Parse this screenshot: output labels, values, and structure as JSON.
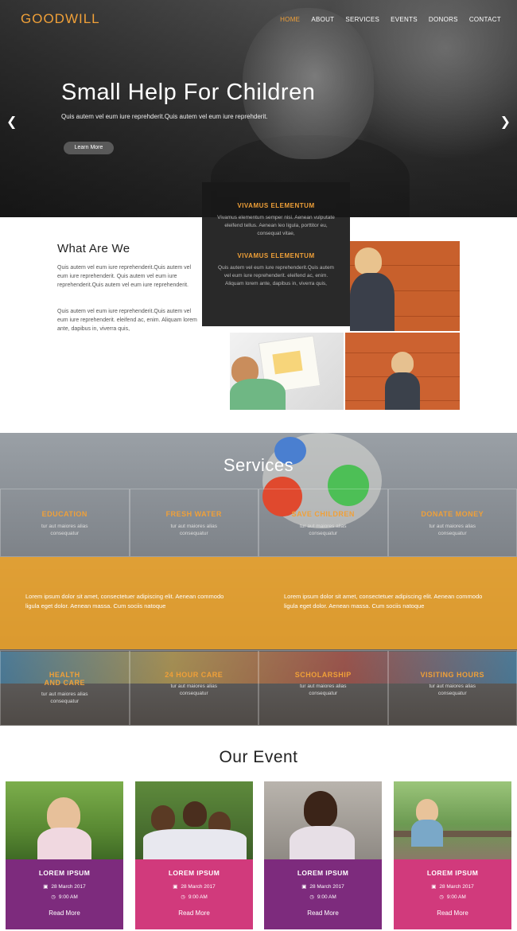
{
  "brand": {
    "logo": "GOODWILL"
  },
  "nav": [
    "HOME",
    "ABOUT",
    "SERVICES",
    "EVENTS",
    "DONORS",
    "CONTACT"
  ],
  "hero": {
    "title": "Small Help For Children",
    "subtitle": "Quis autem vel eum iure reprehderit.Quis autem vel eum iure reprehderit.",
    "button": "Learn More",
    "prev_icon": "chevron-left-icon",
    "next_icon": "chevron-right-icon"
  },
  "about": {
    "title": "What Are We",
    "p1": "Quis autem vel eum iure reprehenderit.Quis autem vel eum iure reprehenderit. Quis autem vel eum iure reprehenderit.Quis autem vel eum iure reprehenderit.",
    "p2": "Quis autem vel eum iure reprehenderit.Quis autem vel eum iure reprehenderit. eleifend ac, enim. Aliquam lorem ante, dapibus in, viverra quis,",
    "box": [
      {
        "heading": "VIVAMUS ELEMENTUM",
        "text": "Vivamus elementum semper nisi. Aenean vulputate eleifend tellus. Aenean leo ligula, porttitor eu, consequat vitae,"
      },
      {
        "heading": "VIVAMUS ELEMENTUM",
        "text": "Quis autem vel eum iure reprehenderit.Quis autem vel eum iure reprehenderit. eleifend ac, enim. Aliquam lorem ante, dapibus in, viverra quis,"
      }
    ]
  },
  "services": {
    "title": "Services",
    "row1": [
      {
        "name": "EDUCATION",
        "desc": "tur aut maiores alias consequatur"
      },
      {
        "name": "FRESH WATER",
        "desc": "tur aut maiores alias consequatur"
      },
      {
        "name": "SAVE CHILDREN",
        "desc": "tur aut maiores alias consequatur"
      },
      {
        "name": "DONATE MONEY",
        "desc": "tur aut maiores alias consequatur"
      }
    ],
    "band": [
      "Lorem ipsum dolor sit amet, consectetuer adipiscing elit. Aenean commodo ligula eget dolor. Aenean massa. Cum sociis natoque",
      "Lorem ipsum dolor sit amet, consectetuer adipiscing elit. Aenean commodo ligula eget dolor. Aenean massa. Cum sociis natoque"
    ],
    "row2": [
      {
        "name": "HEALTH AND CARE",
        "desc": "tur aut maiores alias consequatur"
      },
      {
        "name": "24 HOUR CARE",
        "desc": "tur aut maiores alias consequatur"
      },
      {
        "name": "SCHOLARSHIP",
        "desc": "tur aut maiores alias consequatur"
      },
      {
        "name": "VISITING HOURS",
        "desc": "tur aut maiores alias consequatur"
      }
    ]
  },
  "events": {
    "title": "Our Event",
    "cards": [
      {
        "name": "LOREM IPSUM",
        "date": "28 March 2017",
        "time": "9:00 AM",
        "more": "Read More",
        "color": "#7d2b7d"
      },
      {
        "name": "LOREM IPSUM",
        "date": "28 March 2017",
        "time": "9:00 AM",
        "more": "Read More",
        "color": "#d13a7c"
      },
      {
        "name": "LOREM IPSUM",
        "date": "28 March 2017",
        "time": "9:00 AM",
        "more": "Read More",
        "color": "#7d2b7d"
      },
      {
        "name": "LOREM IPSUM",
        "date": "28 March 2017",
        "time": "9:00 AM",
        "more": "Read More",
        "color": "#d13a7c"
      }
    ]
  },
  "icons": {
    "calendar": "calendar-icon",
    "clock": "clock-icon"
  }
}
